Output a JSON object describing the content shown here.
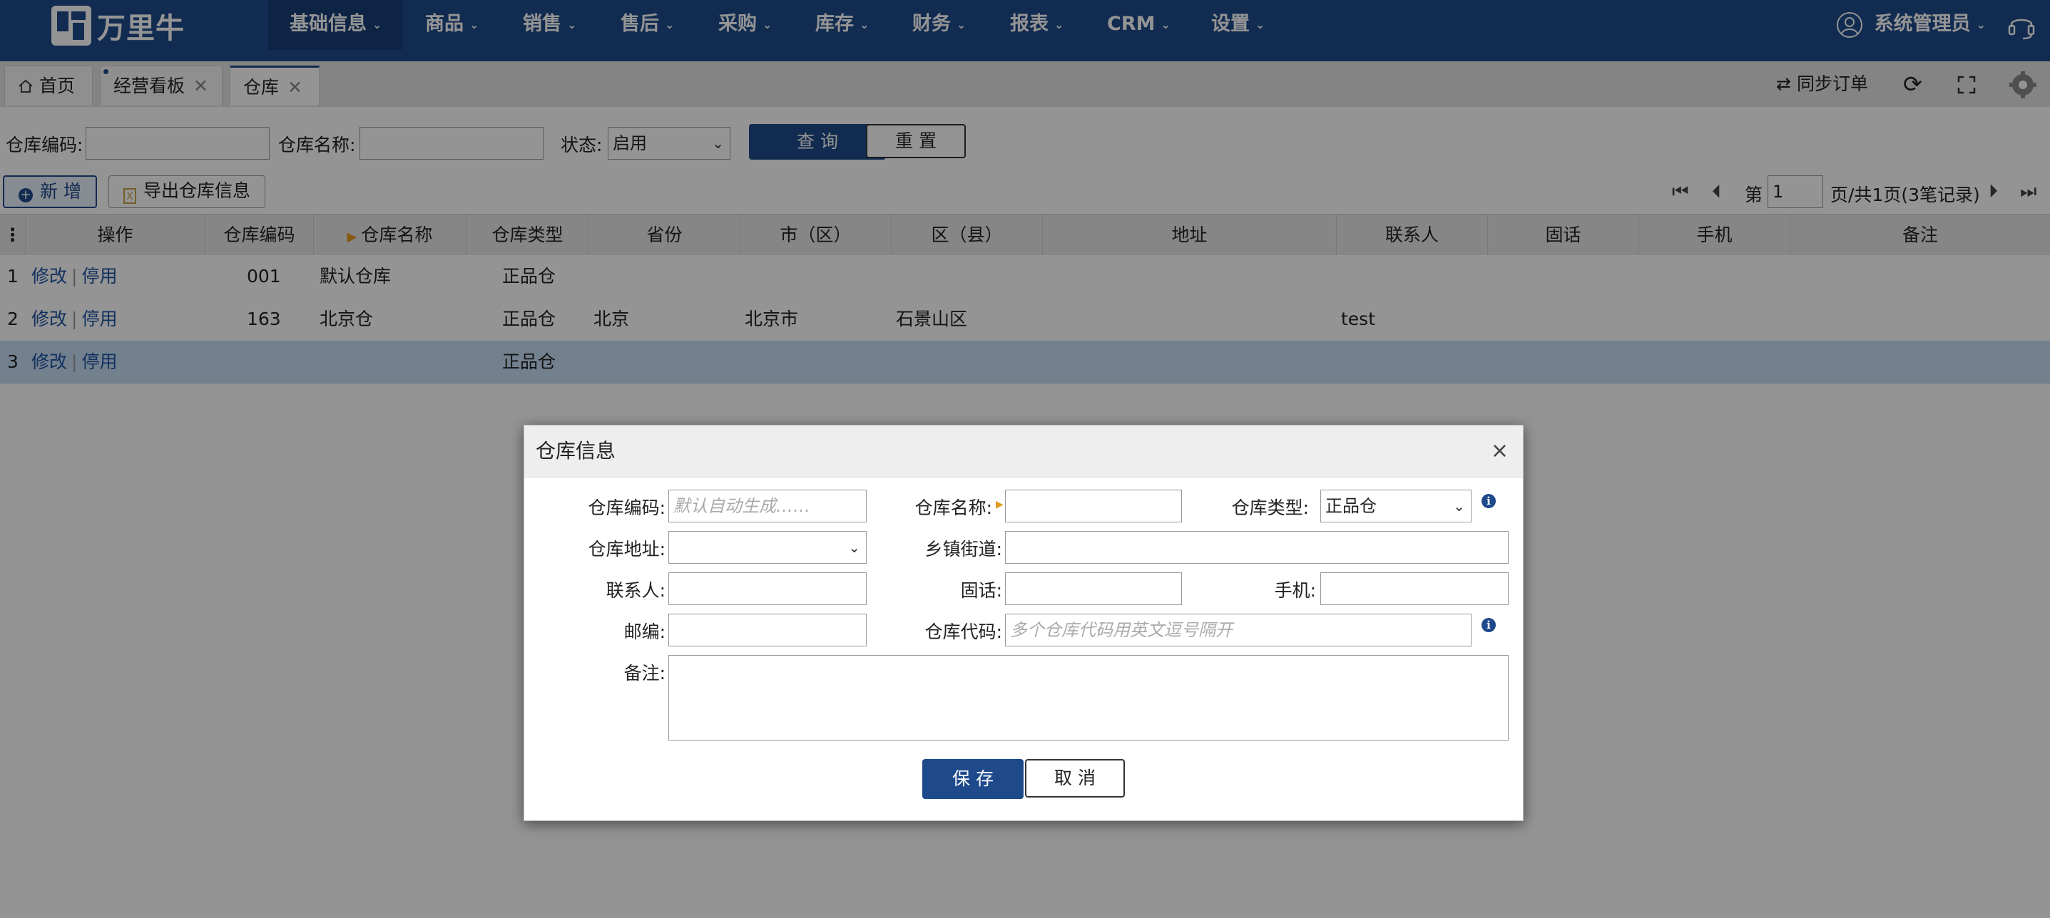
{
  "brand": {
    "name": "万里牛"
  },
  "nav": {
    "items": [
      {
        "label": "基础信息"
      },
      {
        "label": "商品"
      },
      {
        "label": "销售"
      },
      {
        "label": "售后"
      },
      {
        "label": "采购"
      },
      {
        "label": "库存"
      },
      {
        "label": "财务"
      },
      {
        "label": "报表"
      },
      {
        "label": "CRM"
      },
      {
        "label": "设置"
      }
    ],
    "active_index": 0,
    "user": "系统管理员"
  },
  "tabs": [
    {
      "label": "首页"
    },
    {
      "label": "经营看板"
    },
    {
      "label": "仓库"
    }
  ],
  "toolbar": {
    "sync_label": "同步订单"
  },
  "filter": {
    "code_label": "仓库编码:",
    "code_value": "",
    "name_label": "仓库名称:",
    "name_value": "",
    "status_label": "状态:",
    "status_value": "启用",
    "query_label": "查 询",
    "reset_label": "重 置"
  },
  "actions": {
    "add_label": "新 增",
    "export_label": "导出仓库信息"
  },
  "pager": {
    "prefix": "第",
    "page": "1",
    "suffix": "页/共1页(3笔记录)"
  },
  "table": {
    "columns": [
      "操作",
      "仓库编码",
      "仓库名称",
      "仓库类型",
      "省份",
      "市（区）",
      "区（县）",
      "地址",
      "联系人",
      "固话",
      "手机",
      "备注"
    ],
    "rows": [
      {
        "index": "1",
        "edit": "修改",
        "disable": "停用",
        "code": "001",
        "name": "默认仓库",
        "type": "正品仓",
        "province": "",
        "city": "",
        "district": "",
        "address": "",
        "contact": "",
        "phone": "",
        "mobile": "",
        "remark": ""
      },
      {
        "index": "2",
        "edit": "修改",
        "disable": "停用",
        "code": "163",
        "name": "北京仓",
        "type": "正品仓",
        "province": "北京",
        "city": "北京市",
        "district": "石景山区",
        "address": "",
        "contact": "test",
        "phone": "",
        "mobile": "",
        "remark": ""
      },
      {
        "index": "3",
        "edit": "修改",
        "disable": "停用",
        "code": "",
        "name": "",
        "type": "正品仓",
        "province": "",
        "city": "",
        "district": "",
        "address": "",
        "contact": "",
        "phone": "",
        "mobile": "",
        "remark": ""
      }
    ],
    "selected_row": 2
  },
  "dialog": {
    "title": "仓库信息",
    "close": "×",
    "code_label": "仓库编码:",
    "code_placeholder": "默认自动生成……",
    "name_label": "仓库名称:",
    "type_label": "仓库类型:",
    "type_value": "正品仓",
    "address_label": "仓库地址:",
    "street_label": "乡镇街道:",
    "contact_label": "联系人:",
    "phone_label": "固话:",
    "mobile_label": "手机:",
    "zip_label": "邮编:",
    "code2_label": "仓库代码:",
    "code2_placeholder": "多个仓库代码用英文逗号隔开",
    "remark_label": "备注:",
    "save_label": "保 存",
    "cancel_label": "取 消"
  }
}
